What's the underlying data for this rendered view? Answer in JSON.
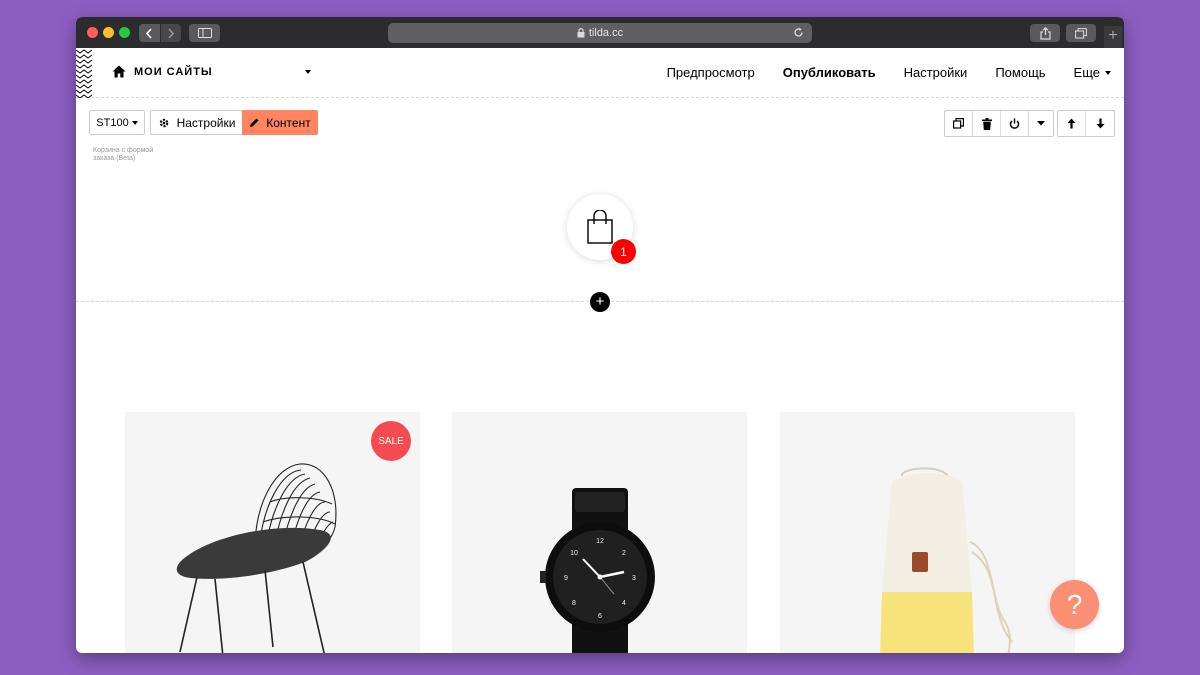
{
  "browser": {
    "url": "tilda.cc",
    "icons": [
      "back-icon",
      "forward-icon",
      "sidebar-icon",
      "lock-icon",
      "reload-icon",
      "share-icon",
      "tabs-icon",
      "new-tab-icon"
    ],
    "new_tab_label": "+"
  },
  "header": {
    "home_label": "МОИ САЙТЫ",
    "menu": {
      "preview": "Предпросмотр",
      "publish": "Опубликовать",
      "settings": "Настройки",
      "help": "Помощь",
      "more": "Еще"
    }
  },
  "block": {
    "code": "ST100",
    "settings_label": "Настройки",
    "content_label": "Контент",
    "description": "Корзина с формой заказа (Beta)",
    "toolbar_icons": [
      "duplicate-icon",
      "delete-icon",
      "power-icon",
      "dropdown-icon",
      "move-up-icon",
      "move-down-icon"
    ]
  },
  "cart": {
    "count": "1",
    "add_block_label": "+"
  },
  "products": [
    {
      "name": "chair",
      "badge": "SALE"
    },
    {
      "name": "watch"
    },
    {
      "name": "bag"
    }
  ],
  "help": {
    "label": "?"
  },
  "colors": {
    "background": "#8c5ec2",
    "accent_orange": "#ff8562",
    "badge_red": "#ff0000",
    "sale_red": "#f54a50",
    "help_orange": "#fb8f74"
  }
}
